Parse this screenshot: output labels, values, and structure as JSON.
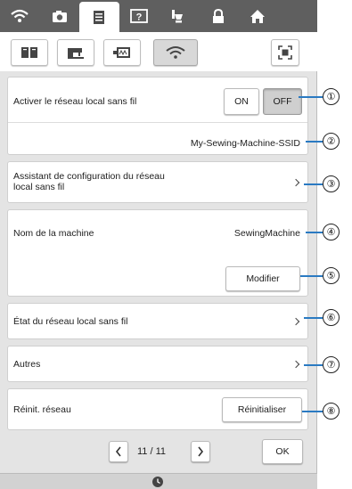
{
  "top_tabs": [
    {
      "icon": "wifi-icon"
    },
    {
      "icon": "camera-icon"
    },
    {
      "icon": "document-icon"
    },
    {
      "icon": "help-icon"
    },
    {
      "icon": "bobbin-icon"
    },
    {
      "icon": "lock-icon"
    },
    {
      "icon": "home-icon"
    }
  ],
  "sub_tabs": [
    {
      "icon": "manual-book-icon"
    },
    {
      "icon": "sewing-machine-icon"
    },
    {
      "icon": "embroidery-frame-icon"
    },
    {
      "icon": "wifi-icon"
    }
  ],
  "rows": {
    "wlan_enable": {
      "label": "Activer le réseau local sans fil",
      "on": "ON",
      "off": "OFF",
      "selected": "OFF"
    },
    "ssid": {
      "value": "My-Sewing-Machine-SSID"
    },
    "setup_wizard": {
      "label_line1": "Assistant de configuration du réseau",
      "label_line2": "local sans fil"
    },
    "machine_name": {
      "label": "Nom de la machine",
      "value": "SewingMachine",
      "button": "Modifier"
    },
    "wlan_status": {
      "label": "État du réseau local sans fil"
    },
    "others": {
      "label": "Autres"
    },
    "reset": {
      "label": "Réinit. réseau",
      "button": "Réinitialiser"
    }
  },
  "pagination": {
    "page_text": "11 / 11",
    "ok": "OK"
  },
  "callouts": [
    "①",
    "②",
    "③",
    "④",
    "⑤",
    "⑥",
    "⑦",
    "⑧"
  ],
  "colors": {
    "callout_line": "#2a7ac2",
    "topbar": "#5f5f5f"
  }
}
